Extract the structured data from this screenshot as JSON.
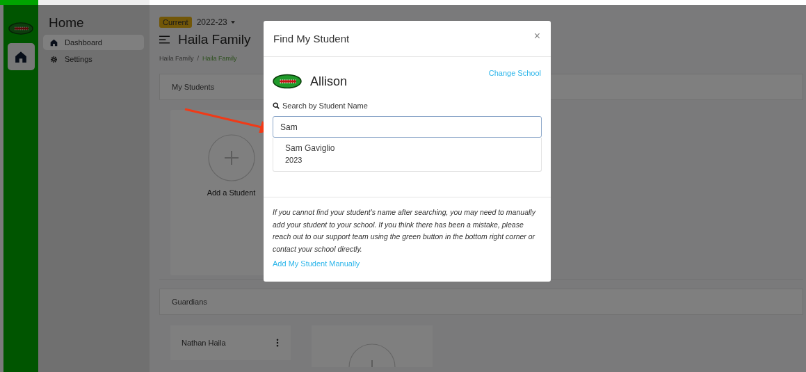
{
  "sidebar": {
    "title": "Home",
    "items": [
      {
        "label": "Dashboard",
        "selected": true
      },
      {
        "label": "Settings",
        "selected": false
      }
    ]
  },
  "header": {
    "badge": "Current",
    "year": "2022-23",
    "title": "Haila Family",
    "breadcrumb": [
      "Haila Family",
      "Haila Family"
    ],
    "breadcrumb_separator": "/"
  },
  "my_students": {
    "title": "My Students",
    "add_label": "Add a Student"
  },
  "guardians": {
    "title": "Guardians",
    "items": [
      {
        "name": "Nathan Haila"
      }
    ]
  },
  "modal": {
    "title": "Find My Student",
    "close": "×",
    "school": "Allison",
    "change_link": "Change School",
    "search_label": "Search by Student Name",
    "search_value": "Sam",
    "results": [
      {
        "name": "Sam Gaviglio",
        "year": "2023"
      }
    ],
    "note": "If you cannot find your student's name after searching, you may need to manually add your student to your school. If you think there has been a mistake, please reach out to our support team using the green button in the bottom right corner or contact your school directly.",
    "manual_link": "Add My Student Manually"
  }
}
